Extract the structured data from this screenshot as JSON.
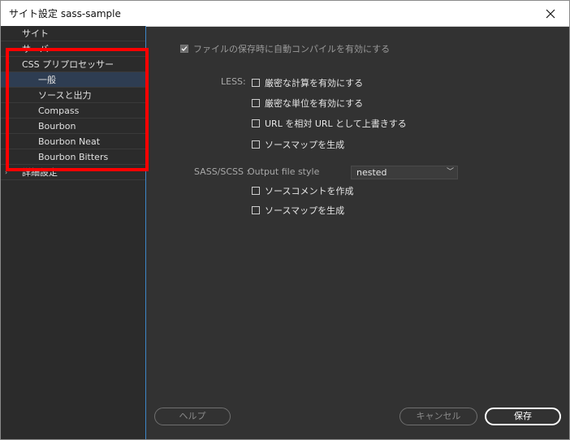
{
  "window": {
    "title": "サイト設定 sass-sample"
  },
  "sidebar": {
    "items": [
      {
        "label": "サイト"
      },
      {
        "label": "サーバー"
      },
      {
        "label": "CSS プリプロセッサー",
        "expanded": true
      },
      {
        "label": "一般",
        "selected": true
      },
      {
        "label": "ソースと出力"
      },
      {
        "label": "Compass"
      },
      {
        "label": "Bourbon"
      },
      {
        "label": "Bourbon Neat"
      },
      {
        "label": "Bourbon Bitters"
      },
      {
        "label": "詳細設定"
      }
    ]
  },
  "main": {
    "autocompile": {
      "label": "ファイルの保存時に自動コンパイルを有効にする",
      "checked": true
    },
    "less": {
      "label": "LESS:",
      "options": [
        {
          "label": "厳密な計算を有効にする",
          "checked": false
        },
        {
          "label": "厳密な単位を有効にする",
          "checked": false
        },
        {
          "label": "URL を相対 URL として上書きする",
          "checked": false
        },
        {
          "label": "ソースマップを生成",
          "checked": false
        }
      ]
    },
    "sass": {
      "label": "SASS/SCSS :",
      "output_label": "Output file style",
      "output_value": "nested",
      "options": [
        {
          "label": "ソースコメントを作成",
          "checked": false
        },
        {
          "label": "ソースマップを生成",
          "checked": false
        }
      ]
    }
  },
  "footer": {
    "help": "ヘルプ",
    "cancel": "キャンセル",
    "save": "保存"
  },
  "colors": {
    "highlight": "#ff0000",
    "selected": "#2e3d52",
    "accent": "#3e86c9"
  }
}
